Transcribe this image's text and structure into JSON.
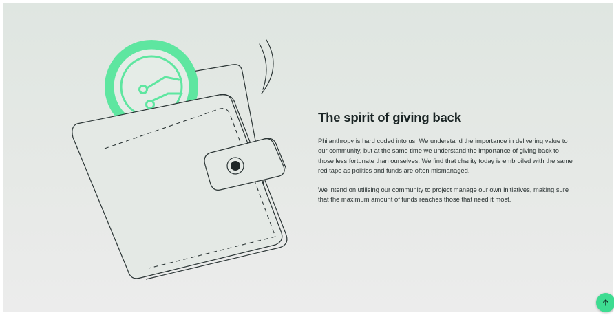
{
  "section": {
    "title": "The spirit of giving back",
    "paragraphs": [
      "Philanthropy is hard coded into us. We understand the importance in delivering value to our community, but at the same time we understand the importance of giving back to those less fortunate than ourselves. We find that charity today is embroiled with the same red tape as politics and funds are often mismanaged.",
      "We intend on utilising our community to project manage our own initiatives, making sure that the maximum amount of funds reaches those that need it most."
    ]
  },
  "illustration": {
    "name": "wallet-with-coin",
    "coin_color": "#5ee6a0",
    "line_color": "#2b3535"
  },
  "scroll_top": {
    "icon": "arrow-up-icon",
    "color": "#3ddc91"
  }
}
